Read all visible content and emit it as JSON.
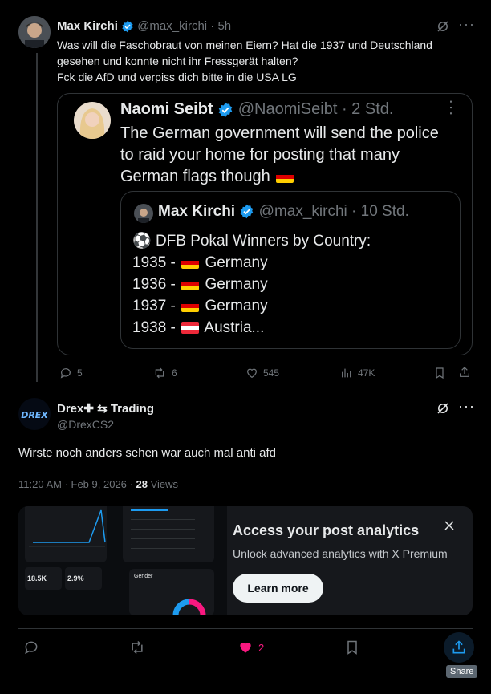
{
  "post1": {
    "author_name": "Max Kirchi",
    "author_handle": "@max_kirchi",
    "time": "· 5h",
    "text_lines": [
      "Was will die Faschobraut von meinen Eiern? Hat die 1937 und Deutschland",
      "gesehen und konnte nicht ihr Fressgerät halten?",
      "Fck die AfD und verpiss dich bitte in die USA LG"
    ],
    "quote": {
      "author_name": "Naomi Seibt",
      "author_handle": "@NaomiSeibt",
      "time": "· 2 Std.",
      "text_lines": [
        "The German government will send the police",
        "to raid your home for posting that many",
        "German flags though"
      ],
      "nested": {
        "author_name": "Max Kirchi",
        "author_handle": "@max_kirchi",
        "time": "· 10 Std.",
        "line1": "DFB Pokal Winners by Country:",
        "rows": [
          {
            "year": "1935 -",
            "country": "Germany"
          },
          {
            "year": "1936 -",
            "country": "Germany"
          },
          {
            "year": "1937 -",
            "country": "Germany"
          },
          {
            "year": "1938 -",
            "country": "Austria..."
          }
        ]
      }
    },
    "actions": {
      "replies": "5",
      "reposts": "6",
      "likes": "545",
      "views": "47K"
    }
  },
  "post2": {
    "author_name": "Drex✚ ⇆ Trading",
    "author_handle": "@DrexCS2",
    "text": "Wirste noch anders sehen war auch mal anti afd",
    "timestamp": "11:20 AM · Feb 9, 2026 ·",
    "views_count": "28",
    "views_label": "Views"
  },
  "promo": {
    "title": "Access your post analytics",
    "subtitle": "Unlock advanced analytics with X Premium",
    "button": "Learn more",
    "thumb_stat1": "18.5K",
    "thumb_stat2": "2.9%",
    "thumb_label": "Gender"
  },
  "bottom_actions": {
    "likes": "2"
  },
  "tooltip": {
    "share": "Share"
  },
  "colors": {
    "accent": "#1d9bf0",
    "like": "#f91880",
    "border": "#2f3336",
    "muted": "#71767b"
  }
}
